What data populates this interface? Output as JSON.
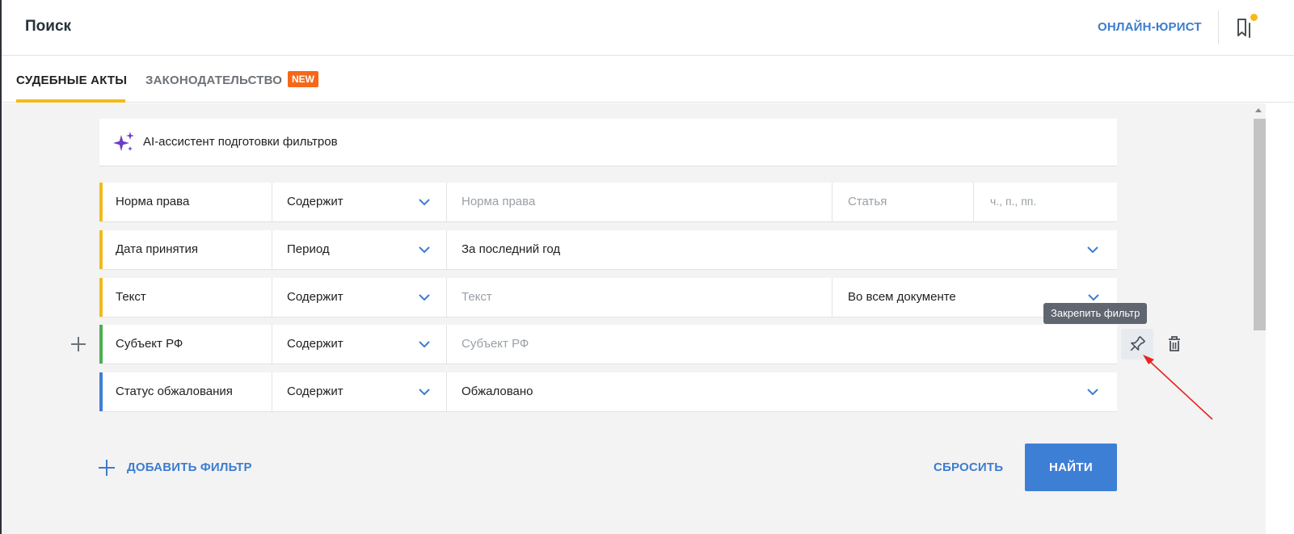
{
  "header": {
    "title": "Поиск",
    "online_lawyer": "ОНЛАЙН-ЮРИСТ"
  },
  "tabs": [
    {
      "label": "СУДЕБНЫЕ АКТЫ",
      "active": true
    },
    {
      "label": "ЗАКОНОДАТЕЛЬСТВО",
      "active": false,
      "badge": "NEW"
    }
  ],
  "ai_assistant": {
    "label": "AI-ассистент подготовки фильтров",
    "icon": "sparkles-icon"
  },
  "filters": [
    {
      "field": "Норма права",
      "operator": "Содержит",
      "value_placeholder": "Норма права",
      "article_placeholder": "Статья",
      "part_placeholder": "ч., п., пп.",
      "accent": "#f5b91a"
    },
    {
      "field": "Дата принятия",
      "operator": "Период",
      "value": "За последний год",
      "accent": "#f5b91a"
    },
    {
      "field": "Текст",
      "operator": "Содержит",
      "value_placeholder": "Текст",
      "scope": "Во всем документе",
      "accent": "#f5b91a"
    },
    {
      "field": "Субъект РФ",
      "operator": "Содержит",
      "value_placeholder": "Субъект РФ",
      "accent": "#4caf50"
    },
    {
      "field": "Статус обжалования",
      "operator": "Содержит",
      "value": "Обжаловано",
      "accent": "#3e7fd6"
    }
  ],
  "tooltip": "Закрепить фильтр",
  "actions": {
    "add_filter": "ДОБАВИТЬ ФИЛЬТР",
    "reset": "СБРОСИТЬ",
    "find": "НАЙТИ"
  },
  "colors": {
    "accent_blue": "#3e7fd6",
    "link_blue": "#3d7ccf",
    "tab_underline": "#f5b91a",
    "badge_orange": "#f5681a",
    "annotation_arrow": "#e8231f"
  }
}
